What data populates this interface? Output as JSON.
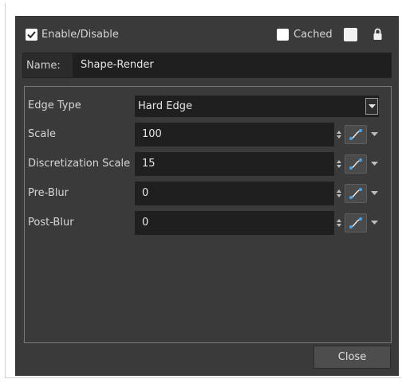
{
  "header": {
    "enable_label": "Enable/Disable",
    "enable_checked": true,
    "cached_label": "Cached",
    "cached_checked": false,
    "swatch_color": "#f2f2f2",
    "lock_icon": "lock-icon"
  },
  "name": {
    "label": "Name:",
    "value": "Shape-Render"
  },
  "params": {
    "edge_type": {
      "label": "Edge Type",
      "value": "Hard Edge"
    },
    "rows": [
      {
        "label": "Scale",
        "value": "100"
      },
      {
        "label": "Discretization Scale",
        "value": "15"
      },
      {
        "label": "Pre-Blur",
        "value": "0"
      },
      {
        "label": "Post-Blur",
        "value": "0"
      }
    ]
  },
  "footer": {
    "close_label": "Close"
  },
  "colors": {
    "dialog_bg": "#3a3a3a",
    "field_bg": "#1f1f1f",
    "text": "#d6d6d6",
    "function_curve_accent": "#4aa3e8"
  }
}
